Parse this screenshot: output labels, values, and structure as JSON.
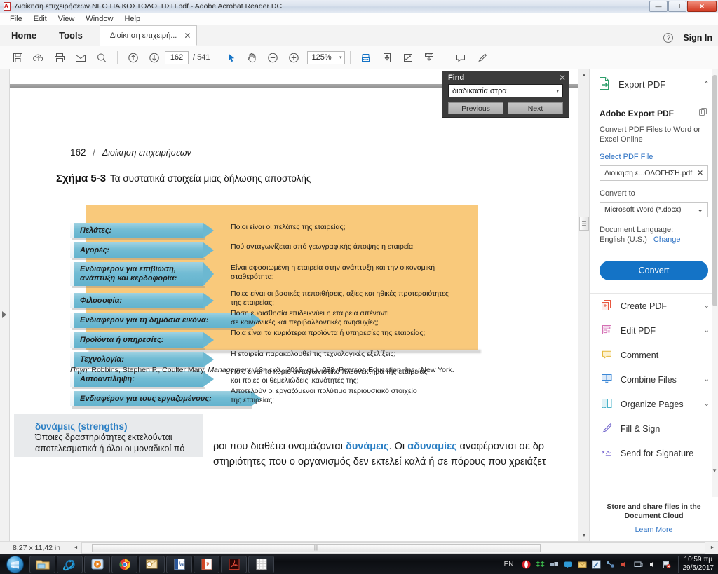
{
  "window": {
    "title": "Διοίκηση επιχειρήσεων ΝΕΟ ΠΑ ΚΟΣΤΟΛΟΓΗΣΗ.pdf - Adobe Acrobat Reader DC",
    "minimize": "—",
    "maximize": "❐",
    "close": "✕"
  },
  "menu": {
    "items": [
      "File",
      "Edit",
      "View",
      "Window",
      "Help"
    ]
  },
  "tabs": {
    "home": "Home",
    "tools": "Tools",
    "document": "Διοίκηση επιχειρή...",
    "document_close": "✕",
    "help_icon": "?",
    "sign_in": "Sign In"
  },
  "toolbar": {
    "icons": [
      "save-icon",
      "upload-cloud-icon",
      "print-icon",
      "email-icon",
      "search-icon",
      "previous-page-icon",
      "next-page-icon",
      "select-tool-icon",
      "hand-tool-icon",
      "zoom-out-icon",
      "zoom-in-icon",
      "fit-width-icon",
      "fit-page-icon",
      "zoom-selection-icon",
      "scroll-mode-icon",
      "comment-icon",
      "highlight-icon"
    ],
    "page_current": "162",
    "page_total": "/ 541",
    "zoom_value": "125%",
    "zoom_caret": "▾"
  },
  "find": {
    "title": "Find",
    "close": "✕",
    "query": "διαδικασία στρα",
    "query_placeholder": "Find",
    "caret": "▾",
    "previous": "Previous",
    "next": "Next"
  },
  "document": {
    "page_number": "162",
    "separator": "/",
    "book_title": "Διοίκηση επιχειρήσεων",
    "figure_label": "Σχήμα 5-3",
    "figure_title": "Τα συστατικά στοιχεία μιας δήλωσης αποστολής",
    "source": "Πηγή: Robbins, Stephen P., Coulter Mary, Management, 13η έκδ., 2016, σελ. 238, Pearson Education, Inc., New York.",
    "source_prefix": "Πηγή:",
    "source_rest": " Robbins, Stephen P., Coulter Mary, ",
    "source_italic": "Management",
    "source_tail": ", 13η έκδ., 2016, σελ. 238, Pearson Education, Inc., New York.",
    "diagram": {
      "bg_color": "#f9c97b",
      "arrow_color": "#6cb8d1",
      "rows": [
        {
          "label": "Πελάτες:",
          "question": "Ποιοι είναι οι πελάτες της εταιρείας;"
        },
        {
          "label": "Αγορές:",
          "question": "Πού ανταγωνίζεται από γεωγραφικής άποψης η εταιρεία;"
        },
        {
          "label": "Ενδιαφέρον για επιβίωση,\nανάπτυξη και κερδοφορία:",
          "question": "Είναι αφοσιωμένη η εταιρεία στην ανάπτυξη και την οικονομική\nσταθερότητα;"
        },
        {
          "label": "Φιλοσοφία:",
          "question": "Ποιες είναι οι βασικές πεποιθήσεις, αξίες και ηθικές προτεραιότητες\nτης εταιρείας;"
        },
        {
          "label": "Ενδιαφέρον για τη δημόσια εικόνα:",
          "question": "Πόση ευαισθησία επιδεικνύει η εταιρεία απέναντι\nσε κοινωνικές και περιβαλλοντικές ανησυχίες;"
        },
        {
          "label": "Προϊόντα ή υπηρεσίες:",
          "question": "Ποια είναι τα κυριότερα προϊόντα ή υπηρεσίες της εταιρείας;"
        },
        {
          "label": "Τεχνολογία:",
          "question": "Η εταιρεία παρακολουθεί τις τεχνολογικές εξελίξεις;"
        },
        {
          "label": "Αυτοαντίληψη:",
          "question": "Ποιο είναι το κύριο ανταγωνιστικό πλεονέκτημα της εταιρείας\nκαι ποιες οι θεμελιώδεις ικανότητές της;"
        },
        {
          "label": "Ενδιαφέρον για τους εργαζομένους:",
          "question": "Αποτελούν οι εργαζόμενοι πολύτιμο περιουσιακό στοιχείο\nτης εταιρείας;"
        }
      ]
    },
    "sidebox": {
      "heading": "δυνάμεις (strengths)",
      "line1": "Όποιες δραστηριότητες εκτελούνται",
      "line2": "αποτελεσματικά ή όλοι οι μοναδικοί πό-"
    },
    "body": {
      "line1_a": "ροι που διαθέτει ονομάζονται ",
      "line1_b": "δυνάμεις",
      "line1_c": ". Οι ",
      "line1_d": "αδυναμίες",
      "line1_e": " αναφέρονται σε δρ",
      "line2": "στηριότητες που ο οργανισμός δεν εκτελεί καλά ή σε πόρους που χρειάζετ"
    }
  },
  "status": {
    "page_size": "8,27 x 11,42 in",
    "left_arrow": "◄",
    "right_arrow": "►"
  },
  "right_panel": {
    "header_title": "Export PDF",
    "header_icon": "export-pdf-icon",
    "header_chevron": "⌃",
    "section_title": "Adobe Export PDF",
    "section_icon": "copy-icon",
    "description": "Convert PDF Files to Word or Excel Online",
    "select_pdf_link": "Select PDF File",
    "file_value": "Διοίκηση ε...ΟΛΟΓΗΣΗ.pdf",
    "file_clear": "✕",
    "convert_to_label": "Convert to",
    "convert_to_value": "Microsoft Word (*.docx)",
    "convert_to_caret": "⌄",
    "doc_language_label": "Document Language:",
    "doc_language_value": "English (U.S.)",
    "doc_language_change": "Change",
    "convert_button": "Convert",
    "tools": [
      {
        "label": "Create PDF",
        "icon": "create-pdf-icon",
        "chevron": "⌄"
      },
      {
        "label": "Edit PDF",
        "icon": "edit-pdf-icon",
        "chevron": "⌄"
      },
      {
        "label": "Comment",
        "icon": "comment-icon",
        "chevron": ""
      },
      {
        "label": "Combine Files",
        "icon": "combine-files-icon",
        "chevron": "⌄"
      },
      {
        "label": "Organize Pages",
        "icon": "organize-pages-icon",
        "chevron": "⌄"
      },
      {
        "label": "Fill & Sign",
        "icon": "fill-sign-icon",
        "chevron": ""
      },
      {
        "label": "Send for Signature",
        "icon": "send-signature-icon",
        "chevron": ""
      }
    ],
    "footer_line1": "Store and share files in the",
    "footer_line2": "Document Cloud",
    "footer_link": "Learn More"
  },
  "taskbar": {
    "start": "start-orb",
    "apps": [
      "windows-explorer-icon",
      "internet-explorer-icon",
      "media-player-icon",
      "google-chrome-icon",
      "outlook-icon",
      "ms-word-icon",
      "ms-publisher-icon",
      "adobe-reader-icon",
      "spreadsheet-icon"
    ],
    "language": "EN",
    "tray_icons": [
      "opera-icon",
      "dropbox-icon",
      "network-icon",
      "messenger-icon",
      "mail-icon",
      "tool-icon",
      "share-icon",
      "speaker-icon",
      "display-icon",
      "volume-icon",
      "flag-alert-icon"
    ],
    "time": "10:59 πμ",
    "date": "29/5/2017"
  }
}
